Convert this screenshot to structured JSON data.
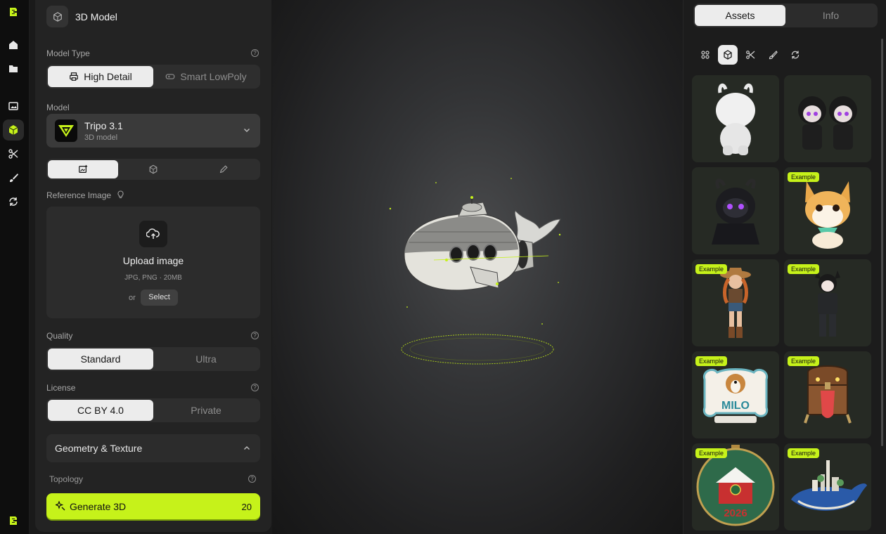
{
  "rail": {
    "items": [
      {
        "name": "logo-icon"
      },
      {
        "name": "home-icon"
      },
      {
        "name": "folder-icon"
      },
      {
        "name": "image-icon"
      },
      {
        "name": "cube-icon",
        "active": true
      },
      {
        "name": "scissors-icon"
      },
      {
        "name": "brush-icon"
      },
      {
        "name": "refresh-icon"
      }
    ]
  },
  "panel": {
    "title": "3D Model",
    "model_type": {
      "label": "Model Type",
      "options": [
        "High Detail",
        "Smart LowPoly"
      ],
      "selected": "High Detail"
    },
    "model": {
      "label": "Model",
      "name": "Tripo 3.1",
      "sub": "3D model"
    },
    "input_tabs": [
      "image-plus-icon",
      "cube-icon",
      "pencil-icon"
    ],
    "reference": {
      "label": "Reference Image",
      "upload_title": "Upload image",
      "formats": "JPG, PNG · 20MB",
      "or": "or",
      "select": "Select"
    },
    "quality": {
      "label": "Quality",
      "options": [
        "Standard",
        "Ultra"
      ],
      "selected": "Standard"
    },
    "license": {
      "label": "License",
      "options": [
        "CC BY 4.0",
        "Private"
      ],
      "selected": "CC BY 4.0"
    },
    "geometry": {
      "label": "Geometry & Texture"
    },
    "topology": {
      "label": "Topology"
    },
    "generate": {
      "label": "Generate 3D",
      "cost": "20"
    }
  },
  "right": {
    "tabs": [
      "Assets",
      "Info"
    ],
    "active_tab": "Assets",
    "filters": [
      "grid-icon",
      "cube-icon",
      "scissors-icon",
      "brush-icon",
      "refresh-icon"
    ],
    "assets": [
      {
        "name": "white-horned-figure",
        "badge": ""
      },
      {
        "name": "dark-twin-figures",
        "badge": ""
      },
      {
        "name": "dark-horned-creature",
        "badge": ""
      },
      {
        "name": "corgi-figure",
        "badge": "Example"
      },
      {
        "name": "cowgirl-figure",
        "badge": "Example"
      },
      {
        "name": "cat-girl-figure",
        "badge": "Example"
      },
      {
        "name": "milo-dog-tag",
        "badge": "Example"
      },
      {
        "name": "treasure-chest-monster",
        "badge": "Example"
      },
      {
        "name": "christmas-ornament",
        "badge": "Example"
      },
      {
        "name": "whale-city",
        "badge": "Example"
      }
    ]
  },
  "colors": {
    "accent": "#c6f21a",
    "panel": "#232323",
    "background": "#1a1a1a"
  }
}
